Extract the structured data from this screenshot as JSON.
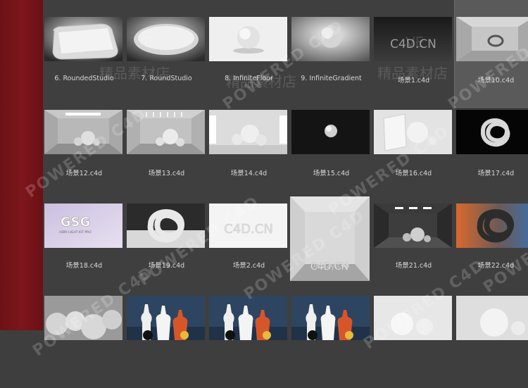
{
  "sidebar": {
    "color": "#7a151b"
  },
  "browser": {
    "rows": [
      {
        "label_top": 112,
        "tiles": [
          {
            "label": "6. RoundedStudio",
            "thumb": "rounded-plate"
          },
          {
            "label": "7. RoundStudio",
            "thumb": "round-plate"
          },
          {
            "label": "8. InfiniteFloor",
            "thumb": "sphere-floor"
          },
          {
            "label": "9. InfiniteGradient",
            "thumb": "sphere-gradient"
          },
          {
            "label": "场景1.c4d",
            "thumb": "c4d-dark"
          },
          {
            "label": "场景10.c4d",
            "thumb": "room-knot",
            "selected": true
          }
        ]
      },
      {
        "label_top": 244,
        "tiles": [
          {
            "label": "场景12.c4d",
            "thumb": "room-spheres"
          },
          {
            "label": "场景13.c4d",
            "thumb": "room-spheres-light"
          },
          {
            "label": "场景14.c4d",
            "thumb": "spheres-window"
          },
          {
            "label": "场景15.c4d",
            "thumb": "sphere-black"
          },
          {
            "label": "场景16.c4d",
            "thumb": "box-sphere"
          },
          {
            "label": "场景17.c4d",
            "thumb": "knot-black"
          }
        ]
      },
      {
        "label_top": 375,
        "tiles": [
          {
            "label": "场景18.c4d",
            "thumb": "gsg-logo"
          },
          {
            "label": "场景19.c4d",
            "thumb": "knot-white"
          },
          {
            "label": "场景2.c4d",
            "thumb": "c4d-white"
          },
          {
            "label": "场景20.c4d",
            "thumb": "room-big",
            "big": true
          },
          {
            "label": "场景21.c4d",
            "thumb": "room-dark-spheres"
          },
          {
            "label": "场景22.c4d",
            "thumb": "knot-colored"
          }
        ]
      },
      {
        "label_top": 520,
        "tiles": [
          {
            "label": "",
            "thumb": "spheres-cluster"
          },
          {
            "label": "",
            "thumb": "vases"
          },
          {
            "label": "",
            "thumb": "vases"
          },
          {
            "label": "",
            "thumb": "vases"
          },
          {
            "label": "",
            "thumb": "spheres-soft"
          },
          {
            "label": "",
            "thumb": "spheres-soft2"
          }
        ]
      }
    ],
    "thumb_text": {
      "c4d_dark": "C4D.CN",
      "c4d_white": "C4D.CN",
      "c4d_room": "C4D.CN",
      "gsg": "GSG",
      "gsg_sub": "HDRI LIGHT KIT PRO"
    },
    "watermarks": [
      "POWERED C4D",
      "POWERED C4D",
      "POWERED C4D",
      "POWERED C4D",
      "精品素材店",
      "精品素材店",
      "精品素材店",
      "POWERED C4D",
      "POWERED C4D",
      "POWERED C4D",
      "VE",
      "VE",
      "POWERED C4D",
      "POWERED C4D"
    ]
  }
}
